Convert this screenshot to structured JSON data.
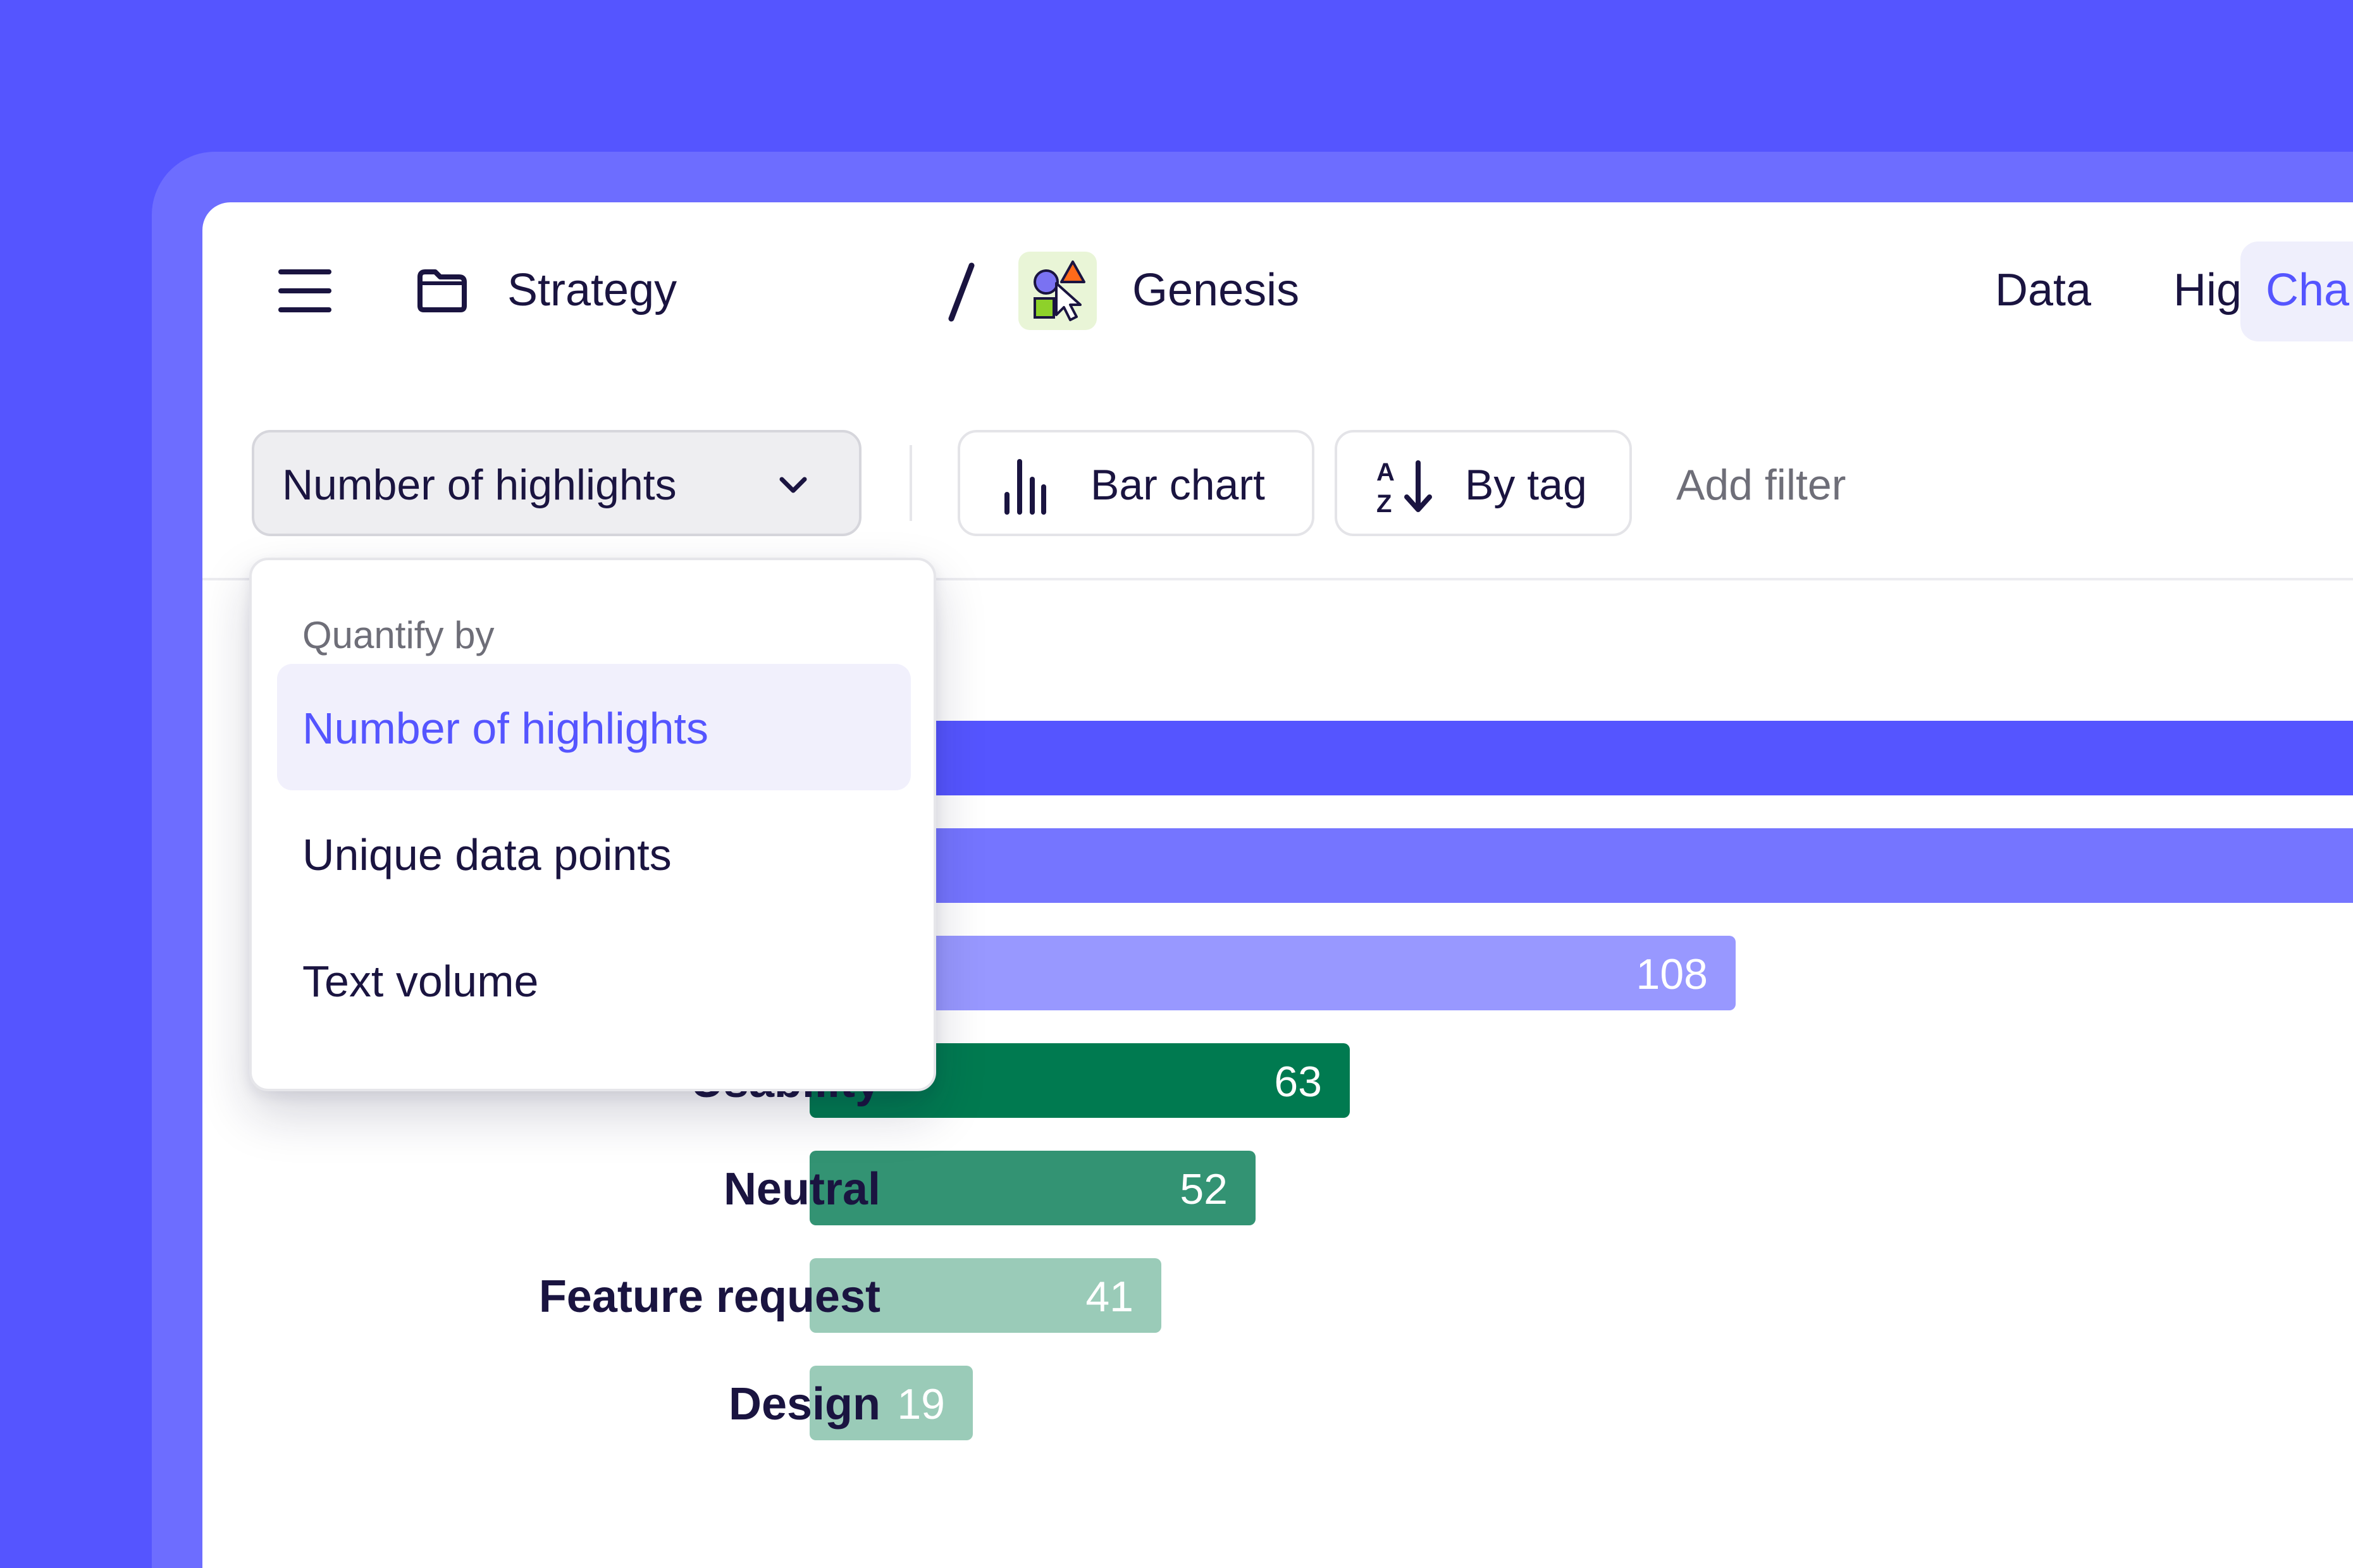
{
  "header": {
    "breadcrumb": {
      "folder": "Strategy",
      "separator": "/",
      "project": "Genesis"
    },
    "nav": {
      "data": "Data",
      "highlights": "Highlights",
      "charts": "Cha"
    }
  },
  "toolbar": {
    "quantify_value": "Number of highlights",
    "chart_type": "Bar chart",
    "sort": "By tag",
    "add_filter": "Add filter"
  },
  "dropdown": {
    "heading": "Quantify by",
    "options": [
      {
        "label": "Number of highlights",
        "selected": true
      },
      {
        "label": "Unique data points",
        "selected": false
      },
      {
        "label": "Text volume",
        "selected": false
      }
    ]
  },
  "colors": {
    "accent": "#5555FF",
    "bars": [
      "#5555FF",
      "#7575FF",
      "#9898FF",
      "#007A50",
      "#339373",
      "#9ACBB8",
      "#9ACBB8"
    ]
  },
  "chart_data": {
    "type": "bar",
    "orientation": "horizontal",
    "categories": [
      "",
      "",
      "",
      "Usability",
      "Neutral",
      "Feature request",
      "Design"
    ],
    "values": [
      null,
      null,
      108,
      63,
      52,
      41,
      19
    ],
    "value_labels": [
      "",
      "",
      "108",
      "63",
      "52",
      "41",
      "19"
    ],
    "xlim": [
      0,
      108
    ]
  }
}
